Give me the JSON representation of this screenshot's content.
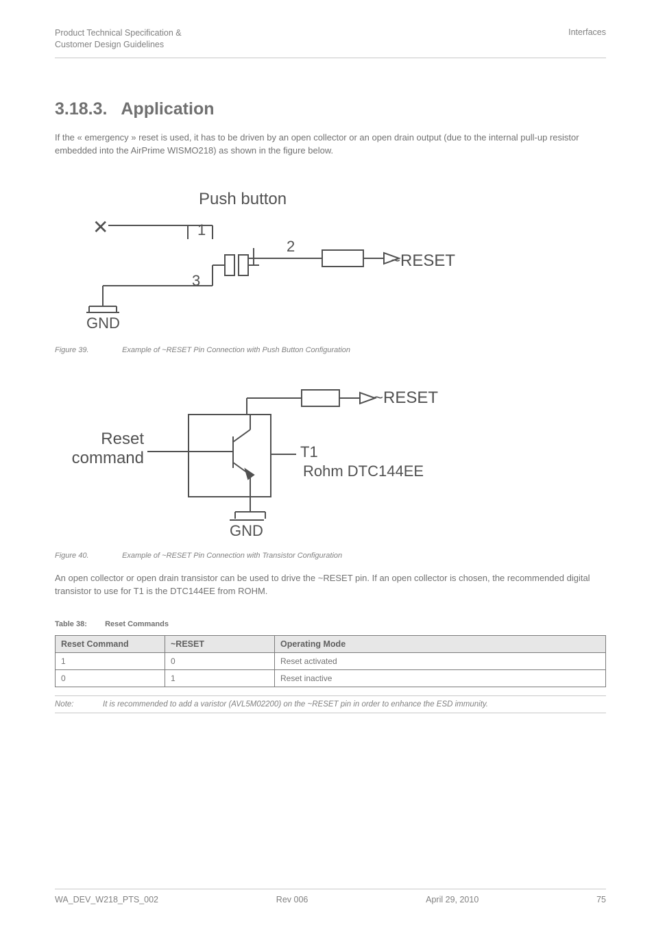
{
  "header": {
    "left_line1": "Product Technical Specification &",
    "left_line2": "Customer Design Guidelines",
    "right": "Interfaces"
  },
  "section": {
    "number": "3.18.3.",
    "title": "Application"
  },
  "para1": "If the « emergency » reset is used, it has to be driven by an open collector or an open drain output (due to the internal pull-up resistor embedded into the AirPrime WISMO218) as shown in the figure below.",
  "fig1": {
    "push_button": "Push button",
    "n1": "1",
    "n2": "2",
    "n3": "3",
    "reset": "~RESET",
    "gnd": "GND",
    "caption_num": "Figure 39.",
    "caption_text": "Example of ~RESET Pin Connection with Push Button Configuration"
  },
  "fig2": {
    "reset": "~RESET",
    "reset_cmd_l1": "Reset",
    "reset_cmd_l2": "command",
    "t1": "T1",
    "rohm": "Rohm DTC144EE",
    "gnd": "GND",
    "caption_num": "Figure 40.",
    "caption_text": "Example of ~RESET Pin Connection with Transistor Configuration"
  },
  "para2": "An open collector or open drain transistor can be used to drive the ~RESET pin. If an open collector is chosen, the recommended digital transistor to use for T1 is the DTC144EE from ROHM.",
  "table": {
    "title_num": "Table 38:",
    "title_text": "Reset Commands",
    "headers": [
      "Reset Command",
      "~RESET",
      "Operating Mode"
    ],
    "rows": [
      [
        "1",
        "0",
        "Reset activated"
      ],
      [
        "0",
        "1",
        "Reset inactive"
      ]
    ]
  },
  "note": {
    "label": "Note:",
    "text": "It is recommended to add a varistor (AVL5M02200) on the ~RESET pin in order to enhance the ESD immunity."
  },
  "footer": {
    "left": "WA_DEV_W218_PTS_002",
    "center": "Rev 006",
    "right": "April 29, 2010",
    "page": "75"
  }
}
